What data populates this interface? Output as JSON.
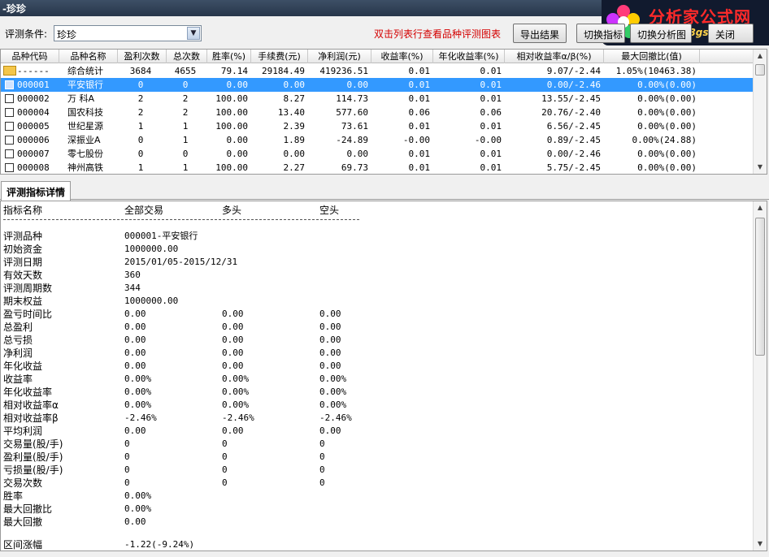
{
  "window": {
    "title": "-珍珍"
  },
  "logo": {
    "text": "分析家公式网",
    "url": "www.88gs.com"
  },
  "toolbar": {
    "criteria_label": "评测条件:",
    "criteria_value": "珍珍",
    "hint": "双击列表行查看品种评测图表",
    "export_label": "导出结果",
    "switch_label": "切换指标",
    "switch2_label": "切换分析图",
    "close_label": "关闭"
  },
  "grid": {
    "columns": [
      "品种代码",
      "品种名称",
      "盈利次数",
      "总次数",
      "胜率(%)",
      "手续费(元)",
      "净利润(元)",
      "收益率(%)",
      "年化收益率(%)",
      "相对收益率α/β(%)",
      "最大回撤比(值)"
    ],
    "summary": [
      "------",
      "综合统计",
      "3684",
      "4655",
      "79.14",
      "29184.49",
      "419236.51",
      "0.01",
      "0.01",
      "9.07/-2.44",
      "1.05%(10463.38)"
    ],
    "rows": [
      [
        "000001",
        "平安银行",
        "0",
        "0",
        "0.00",
        "0.00",
        "0.00",
        "0.01",
        "0.01",
        "0.00/-2.46",
        "0.00%(0.00)"
      ],
      [
        "000002",
        "万  科A",
        "2",
        "2",
        "100.00",
        "8.27",
        "114.73",
        "0.01",
        "0.01",
        "13.55/-2.45",
        "0.00%(0.00)"
      ],
      [
        "000004",
        "国农科技",
        "2",
        "2",
        "100.00",
        "13.40",
        "577.60",
        "0.06",
        "0.06",
        "20.76/-2.40",
        "0.00%(0.00)"
      ],
      [
        "000005",
        "世纪星源",
        "1",
        "1",
        "100.00",
        "2.39",
        "73.61",
        "0.01",
        "0.01",
        "6.56/-2.45",
        "0.00%(0.00)"
      ],
      [
        "000006",
        "深振业A",
        "0",
        "1",
        "0.00",
        "1.89",
        "-24.89",
        "-0.00",
        "-0.00",
        "0.89/-2.45",
        "0.00%(24.88)"
      ],
      [
        "000007",
        "零七股份",
        "0",
        "0",
        "0.00",
        "0.00",
        "0.00",
        "0.01",
        "0.01",
        "0.00/-2.46",
        "0.00%(0.00)"
      ],
      [
        "000008",
        "神州高铁",
        "1",
        "1",
        "100.00",
        "2.27",
        "69.73",
        "0.01",
        "0.01",
        "5.75/-2.45",
        "0.00%(0.00)"
      ]
    ]
  },
  "detail": {
    "tab_label": "评测指标详情",
    "headers": [
      "指标名称",
      "全部交易",
      "多头",
      "空头"
    ],
    "info": [
      [
        "评测品种",
        "000001-平安银行"
      ],
      [
        "初始资金",
        "1000000.00"
      ],
      [
        "评测日期",
        "2015/01/05-2015/12/31"
      ],
      [
        "有效天数",
        "360"
      ],
      [
        "评测周期数",
        "344"
      ],
      [
        "期末权益",
        "1000000.00"
      ]
    ],
    "metrics": [
      [
        "盈亏时间比",
        "0.00",
        "0.00",
        "0.00"
      ],
      [
        "总盈利",
        "0.00",
        "0.00",
        "0.00"
      ],
      [
        "总亏损",
        "0.00",
        "0.00",
        "0.00"
      ],
      [
        "净利润",
        "0.00",
        "0.00",
        "0.00"
      ],
      [
        "年化收益",
        "0.00",
        "0.00",
        "0.00"
      ],
      [
        "收益率",
        "0.00%",
        "0.00%",
        "0.00%"
      ],
      [
        "年化收益率",
        "0.00%",
        "0.00%",
        "0.00%"
      ],
      [
        "相对收益率α",
        "0.00%",
        "0.00%",
        "0.00%"
      ],
      [
        "相对收益率β",
        "-2.46%",
        "-2.46%",
        "-2.46%"
      ],
      [
        "平均利润",
        "0.00",
        "0.00",
        "0.00"
      ],
      [
        "交易量(股/手)",
        "0",
        "0",
        "0"
      ],
      [
        "盈利量(股/手)",
        "0",
        "0",
        "0"
      ],
      [
        "亏损量(股/手)",
        "0",
        "0",
        "0"
      ],
      [
        "交易次数",
        "0",
        "0",
        "0"
      ],
      [
        "胜率",
        "0.00%",
        "",
        ""
      ],
      [
        "最大回撤比",
        "0.00%",
        "",
        ""
      ],
      [
        "最大回撤",
        "0.00",
        "",
        ""
      ]
    ],
    "range_label": "区间涨幅",
    "range_value": "-1.22(-9.24%)"
  }
}
